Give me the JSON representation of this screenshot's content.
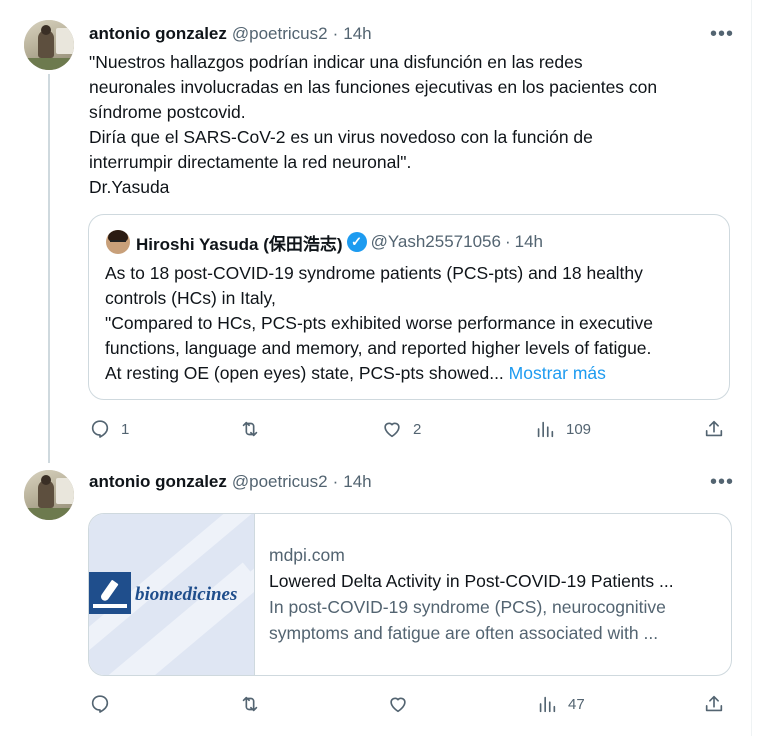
{
  "tweet1": {
    "author_name": "antonio gonzalez",
    "handle": "@poetricus2",
    "sep": "·",
    "time": "14h",
    "more": "•••",
    "lines": [
      "\"Nuestros hallazgos podrían indicar una disfunción en las redes",
      "neuronales involucradas en las funciones ejecutivas en los pacientes con",
      "síndrome postcovid.",
      "Diría que el SARS-CoV-2 es un virus novedoso con la función de",
      "interrumpir directamente la red neuronal\".",
      "Dr.Yasuda"
    ],
    "quote": {
      "author_name": "Hiroshi Yasuda (保田浩志)",
      "verified": "✓",
      "handle": "@Yash25571056",
      "sep": "·",
      "time": "14h",
      "lines": [
        "As to 18 post-COVID-19 syndrome patients (PCS-pts) and 18 healthy",
        "controls (HCs) in Italy,",
        "\"Compared to HCs, PCS-pts exhibited worse performance in executive",
        "functions, language and memory, and reported higher levels of fatigue.",
        "At resting OE (open eyes) state, PCS-pts showed..."
      ],
      "show_more": "Mostrar más"
    },
    "actions": {
      "replies": "1",
      "reposts": "",
      "likes": "2",
      "views": "109"
    }
  },
  "tweet2": {
    "author_name": "antonio gonzalez",
    "handle": "@poetricus2",
    "sep": "·",
    "time": "14h",
    "more": "•••",
    "card": {
      "logo_text": "biomedicines",
      "domain": "mdpi.com",
      "title": "Lowered Delta Activity in Post-COVID-19 Patients ...",
      "desc_lines": [
        "In post-COVID-19 syndrome (PCS), neurocognitive",
        "symptoms and fatigue are often associated with ..."
      ]
    },
    "actions": {
      "replies": "",
      "reposts": "",
      "likes": "",
      "views": "47"
    }
  },
  "icons": {
    "reply": "reply-icon",
    "repost": "repost-icon",
    "like": "like-icon",
    "views": "views-icon",
    "share": "share-icon"
  },
  "colors": {
    "text": "#0f1419",
    "muted": "#536471",
    "link": "#1d9bf0",
    "border": "#cfd9de"
  }
}
